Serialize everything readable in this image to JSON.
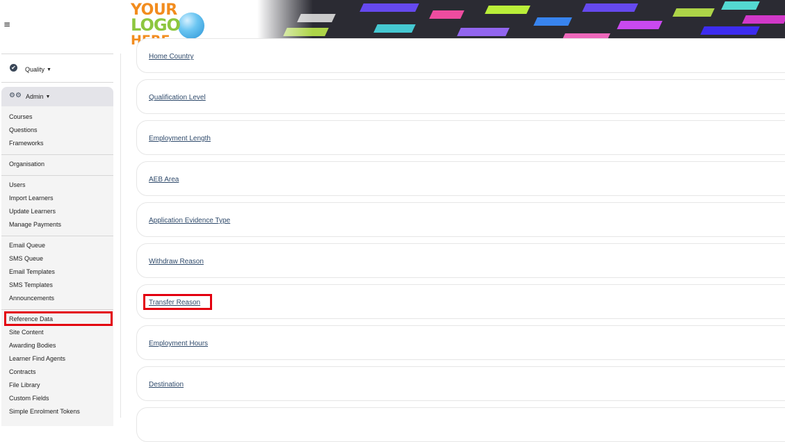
{
  "header": {
    "menu_icon": "≡",
    "logo": {
      "line1": "YOUR",
      "line2": "LOGO",
      "line3": "HERE"
    }
  },
  "sidebar": {
    "quality": {
      "label": "Quality",
      "icon": "check-circle-icon"
    },
    "admin": {
      "label": "Admin",
      "icon": "gears-icon"
    },
    "groups": [
      [
        "Courses",
        "Questions",
        "Frameworks"
      ],
      [
        "Organisation"
      ],
      [
        "Users",
        "Import Learners",
        "Update Learners",
        "Manage Payments"
      ],
      [
        "Email Queue",
        "SMS Queue",
        "Email Templates",
        "SMS Templates",
        "Announcements"
      ],
      [
        "Reference Data",
        "Site Content",
        "Awarding Bodies",
        "Learner Find Agents",
        "Contracts",
        "File Library",
        "Custom Fields",
        "Simple Enrolment Tokens"
      ]
    ],
    "highlighted_item": "Reference Data"
  },
  "reference_types": [
    "Home Country",
    "Qualification Level",
    "Employment Length",
    "AEB Area",
    "Application Evidence Type",
    "Withdraw Reason",
    "Transfer Reason",
    "Employment Hours",
    "Destination"
  ],
  "highlighted_link": "Transfer Reason",
  "colors": {
    "highlight": "#e3000f",
    "link": "#2f4a6b",
    "sidebar_bg": "#f4f4f4"
  }
}
